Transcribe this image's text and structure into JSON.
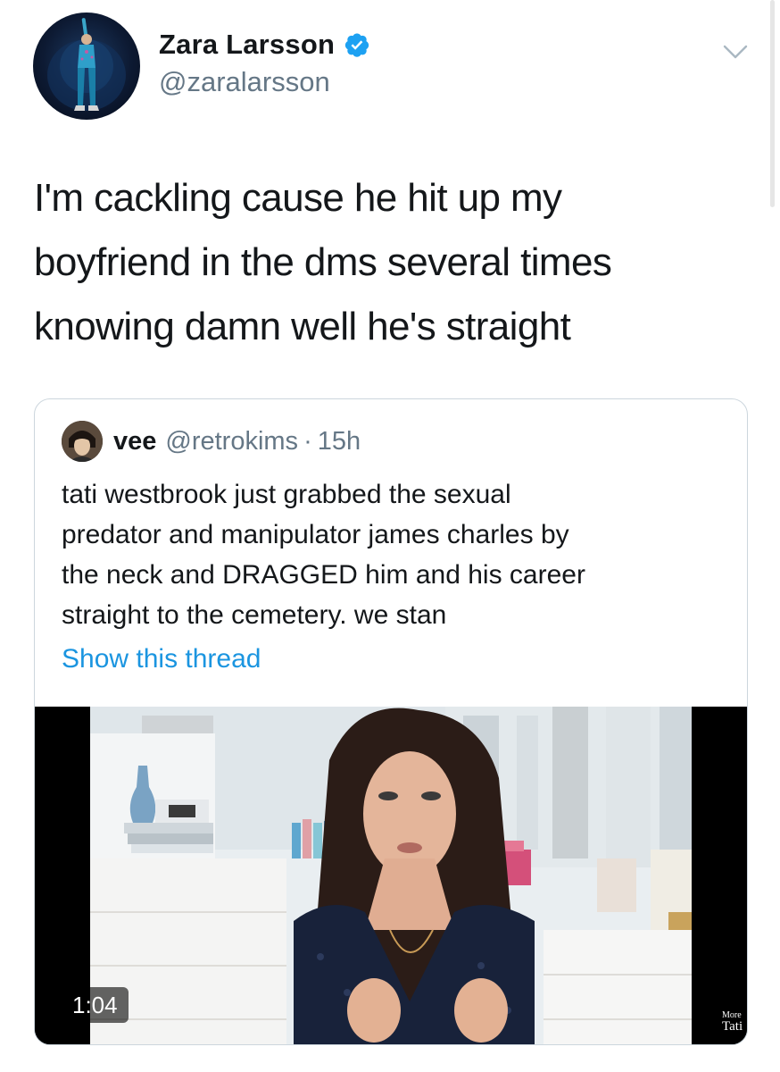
{
  "tweet": {
    "author": {
      "display_name": "Zara Larsson",
      "handle": "@zaralarsson",
      "verified": true
    },
    "text": "I'm cackling cause he hit up my\nboyfriend in the dms several times\nknowing damn well he's straight",
    "menu_icon": "chevron-down-icon"
  },
  "quoted_tweet": {
    "author": {
      "display_name": "vee",
      "handle": "@retrokims",
      "separator": "·",
      "time": "15h"
    },
    "text": "tati westbrook just grabbed the  sexual\npredator and manipulator james charles by\nthe neck and DRAGGED him and his career\nstraight to the cemetery. we stan",
    "show_thread_label": "Show this thread",
    "video": {
      "duration": "1:04",
      "watermark_top": "More",
      "watermark_bottom": "Tati"
    }
  },
  "colors": {
    "text": "#14171a",
    "secondary": "#657786",
    "link": "#1b95e0",
    "verified": "#1da1f2",
    "border": "#ccd6dd"
  }
}
